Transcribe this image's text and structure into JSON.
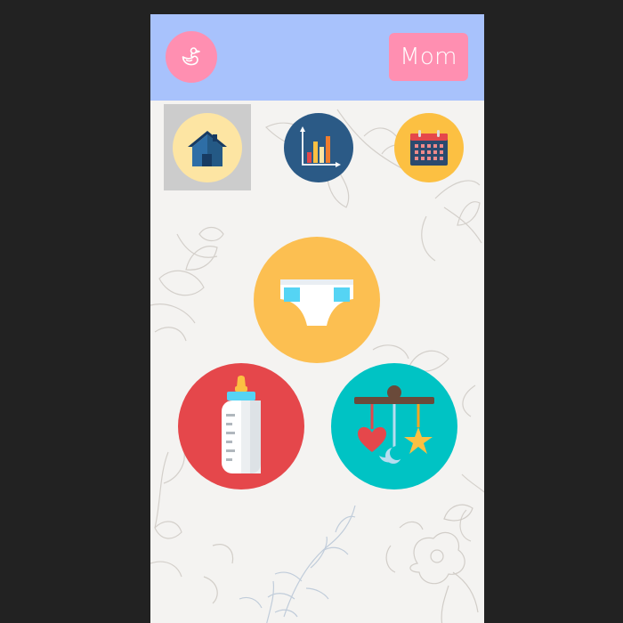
{
  "header": {
    "logo_icon": "duck-icon",
    "user_button_label": "Mom",
    "background_color": "#a8c2fc",
    "accent_color": "#ff8fb1"
  },
  "nav": {
    "tabs": [
      {
        "id": "home",
        "icon": "house-icon",
        "color": "#fde5a3",
        "active": true
      },
      {
        "id": "stats",
        "icon": "bar-chart-icon",
        "color": "#2b5a86",
        "active": false
      },
      {
        "id": "calendar",
        "icon": "calendar-icon",
        "color": "#fcc042",
        "active": false
      }
    ]
  },
  "actions": [
    {
      "id": "diaper",
      "icon": "diaper-icon",
      "color": "#fcbf51"
    },
    {
      "id": "feeding",
      "icon": "baby-bottle-icon",
      "color": "#e5474b"
    },
    {
      "id": "sleep",
      "icon": "crib-mobile-icon",
      "color": "#00c3c4"
    }
  ]
}
